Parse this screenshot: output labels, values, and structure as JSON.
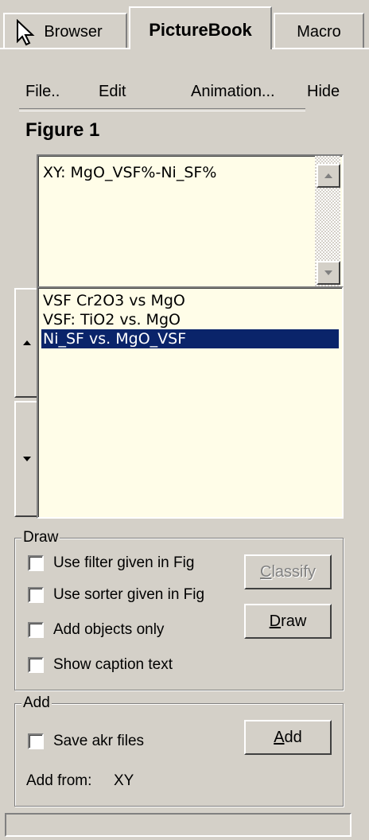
{
  "tabs": [
    {
      "label": "Browser",
      "active": false
    },
    {
      "label": "PictureBook",
      "active": true
    },
    {
      "label": "Macro",
      "active": false
    }
  ],
  "menu": {
    "file": "File..",
    "edit": "Edit",
    "animation": "Animation...",
    "hide": "Hide"
  },
  "figure": {
    "title": "Figure 1",
    "description": "XY: MgO_VSF%-Ni_SF%"
  },
  "plot_list": {
    "items": [
      {
        "label": "VSF Cr2O3 vs MgO",
        "selected": false
      },
      {
        "label": "VSF: TiO2 vs. MgO",
        "selected": false
      },
      {
        "label": "Ni_SF vs. MgO_VSF",
        "selected": true
      }
    ],
    "selected_bg": "#0a246a"
  },
  "draw_group": {
    "label": "Draw",
    "checkboxes": [
      {
        "label": "Use filter given in Fig",
        "checked": false
      },
      {
        "label": "Use sorter given in Fig",
        "checked": false
      },
      {
        "label": "Add objects only",
        "checked": false
      },
      {
        "label": "Show caption text",
        "checked": false
      }
    ],
    "classify_label": "Classify",
    "classify_mnemonic": "C",
    "classify_rest": "lassify",
    "draw_mnemonic": "D",
    "draw_rest": "raw"
  },
  "add_group": {
    "label": "Add",
    "save_akr": {
      "label": "Save akr files",
      "checked": false
    },
    "add_mnemonic": "A",
    "add_rest": "dd",
    "add_from_label": "Add from:",
    "add_from_value": "XY"
  },
  "colors": {
    "panel": "#d4d0c8",
    "list_bg": "#fffde8"
  }
}
